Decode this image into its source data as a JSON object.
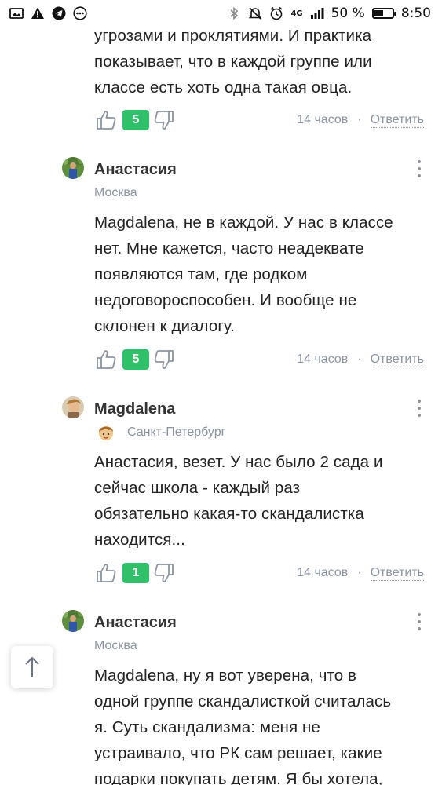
{
  "status_bar": {
    "battery_percent": "50 %",
    "time": "8:50",
    "network": "4G",
    "icons": [
      "image-icon",
      "warning-icon",
      "telegram-icon",
      "more-circle-icon",
      "bluetooth-icon",
      "mute-icon",
      "alarm-icon",
      "signal-icon",
      "battery-icon"
    ],
    "battery_level": 0.5
  },
  "comments": [
    {
      "partial": true,
      "text_lines": [
        "угрозами и проклятиями. И практика",
        "показывает, что в каждой группе или",
        "классе есть хоть одна такая овца."
      ],
      "likes": "5",
      "time": "14 часов",
      "separator": "·",
      "reply_label": "Ответить"
    },
    {
      "author": "Анастасия",
      "city": "Москва",
      "text_lines": [
        "Magdalena, не в каждой. У нас в классе",
        "нет. Мне кажется, часто неадеквате",
        "появляются там, где родком",
        "недоговороспособен. И вообще не",
        "склонен к диалогу."
      ],
      "likes": "5",
      "time": "14 часов",
      "separator": "·",
      "reply_label": "Ответить"
    },
    {
      "author": "Magdalena",
      "city": "Санкт-Петербург",
      "text_lines": [
        "Анастасия, везет. У нас было 2 сада и",
        "сейчас школа - каждый раз",
        "обязательно какая-то скандалистка",
        "находится..."
      ],
      "likes": "1",
      "time": "14 часов",
      "separator": "·",
      "reply_label": "Ответить"
    },
    {
      "author": "Анастасия",
      "city": "Москва",
      "text_lines": [
        "Magdalena, ну я вот уверена, что в",
        "одной группе скандалисткой считалась",
        "я. Суть скандализма: меня не",
        "устраивало, что РК сам решает, какие",
        "подарки покупать детям. Я бы хотела,"
      ]
    }
  ],
  "colors": {
    "likes_badge": "#2fc16a",
    "meta_text": "#8b95a1",
    "body_text": "#222222"
  }
}
